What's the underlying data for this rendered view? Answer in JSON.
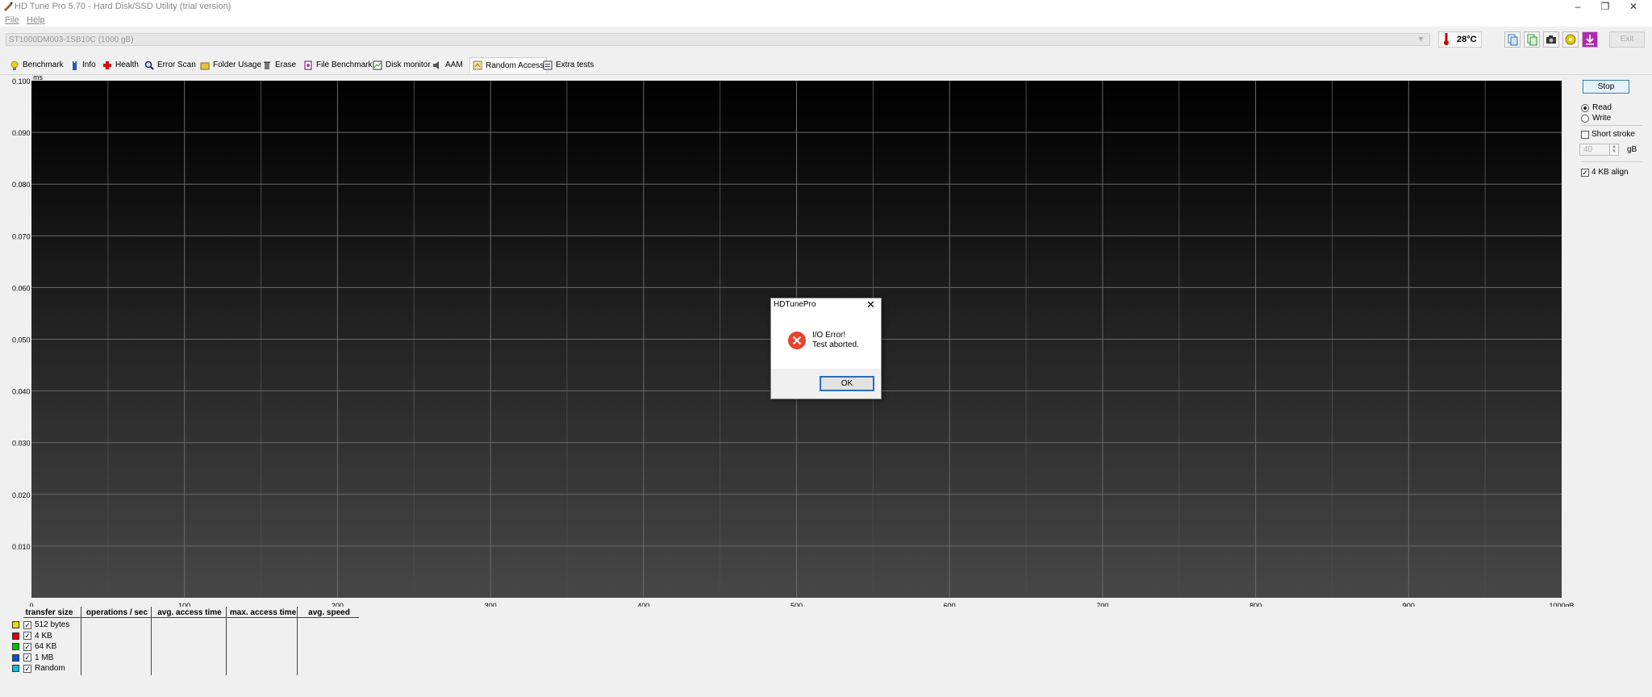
{
  "window": {
    "title": "HD Tune Pro 5.70 - Hard Disk/SSD Utility (trial version)",
    "controls": {
      "minimize": "–",
      "restore": "❐",
      "close": "✕"
    }
  },
  "menu": {
    "file": "File",
    "help": "Help"
  },
  "drive": {
    "selected": "ST1000DM003-1SB10C (1000 gB)"
  },
  "temperature": "28°C",
  "toolbar": {
    "exit_label": "Exit"
  },
  "tabs": [
    {
      "label": "Benchmark",
      "icon": "lightbulb-icon"
    },
    {
      "label": "Info",
      "icon": "info-icon"
    },
    {
      "label": "Health",
      "icon": "health-cross-icon"
    },
    {
      "label": "Error Scan",
      "icon": "magnifier-icon"
    },
    {
      "label": "Folder Usage",
      "icon": "folder-icon"
    },
    {
      "label": "Erase",
      "icon": "trash-icon"
    },
    {
      "label": "File Benchmark",
      "icon": "file-benchmark-icon"
    },
    {
      "label": "Disk monitor",
      "icon": "monitor-chart-icon"
    },
    {
      "label": "AAM",
      "icon": "speaker-icon"
    },
    {
      "label": "Random Access",
      "icon": "random-access-icon"
    },
    {
      "label": "Extra tests",
      "icon": "extra-tests-icon"
    }
  ],
  "chart_data": {
    "type": "scatter",
    "ylabel": "ms",
    "xlim": [
      0,
      1000
    ],
    "ylim": [
      0,
      0.1
    ],
    "x_ticks": [
      "0",
      "100",
      "200",
      "300",
      "400",
      "500",
      "600",
      "700",
      "800",
      "900",
      "1000gB"
    ],
    "y_ticks": [
      "0.100",
      "0.090",
      "0.080",
      "0.070",
      "0.060",
      "0.050",
      "0.040",
      "0.030",
      "0.020",
      "0.010"
    ],
    "grid": true,
    "series": []
  },
  "panel": {
    "stop_label": "Stop",
    "read_label": "Read",
    "write_label": "Write",
    "short_stroke_label": "Short stroke",
    "short_stroke_value": "40",
    "unit": "gB",
    "align_label": "4 KB align"
  },
  "results": {
    "headers": [
      "transfer size",
      "operations / sec",
      "avg. access time",
      "max. access time",
      "avg. speed"
    ],
    "rows": [
      {
        "label": "512 bytes",
        "color": "#e8e000"
      },
      {
        "label": "4 KB",
        "color": "#e00000"
      },
      {
        "label": "64 KB",
        "color": "#00c000"
      },
      {
        "label": "1 MB",
        "color": "#0050e0"
      },
      {
        "label": "Random",
        "color": "#00c0e0"
      }
    ]
  },
  "dialog": {
    "title": "HDTunePro",
    "close": "✕",
    "message_line1": "I/O Error!",
    "message_line2": "Test aborted.",
    "ok_label": "OK"
  }
}
